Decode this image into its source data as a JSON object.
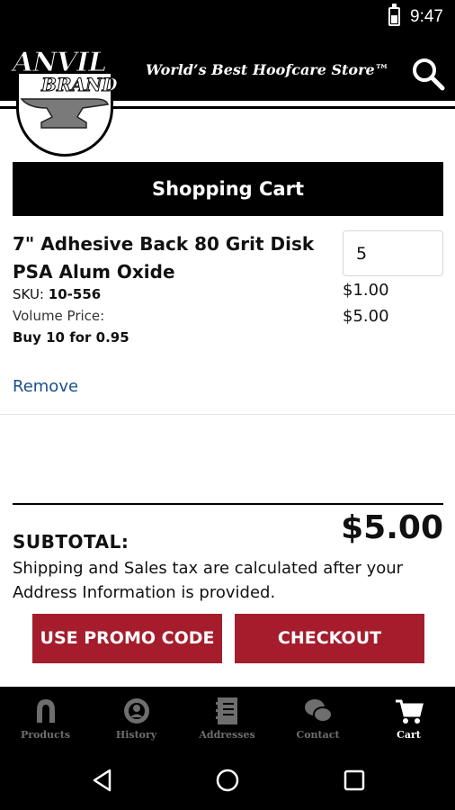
{
  "status_bar": {
    "time": "9:47",
    "battery_icon": "battery-charging-icon"
  },
  "header": {
    "logo_text_top": "ANVIL",
    "logo_text_bottom": "BRAND",
    "tagline": "World’s Best Hoofcare Store™",
    "search_icon": "search-icon"
  },
  "cart": {
    "title": "Shopping Cart",
    "item": {
      "name": "7\" Adhesive Back 80 Grit Disk PSA Alum Oxide",
      "sku_label": "SKU:",
      "sku_value": "10-556",
      "volume_label": "Volume Price:",
      "volume_value": "Buy 10 for 0.95",
      "quantity": "5",
      "unit_price": "$1.00",
      "line_total": "$5.00",
      "remove_label": "Remove"
    },
    "subtotal_label": "SUBTOTAL:",
    "subtotal_value": "$5.00",
    "tax_note": "Shipping and Sales tax are calculated after your Address Information is provided.",
    "promo_button": "USE PROMO CODE",
    "checkout_button": "CHECKOUT"
  },
  "tabs": [
    {
      "label": "Products",
      "icon": "horseshoe-icon",
      "active": false
    },
    {
      "label": "History",
      "icon": "history-icon",
      "active": false
    },
    {
      "label": "Addresses",
      "icon": "address-book-icon",
      "active": false
    },
    {
      "label": "Contact",
      "icon": "chat-bubbles-icon",
      "active": false
    },
    {
      "label": "Cart",
      "icon": "cart-icon",
      "active": true
    }
  ],
  "colors": {
    "accent": "#a51d2d",
    "link": "#1a4f8f",
    "header_bg": "#000000",
    "tab_inactive": "#6e6e6e"
  }
}
